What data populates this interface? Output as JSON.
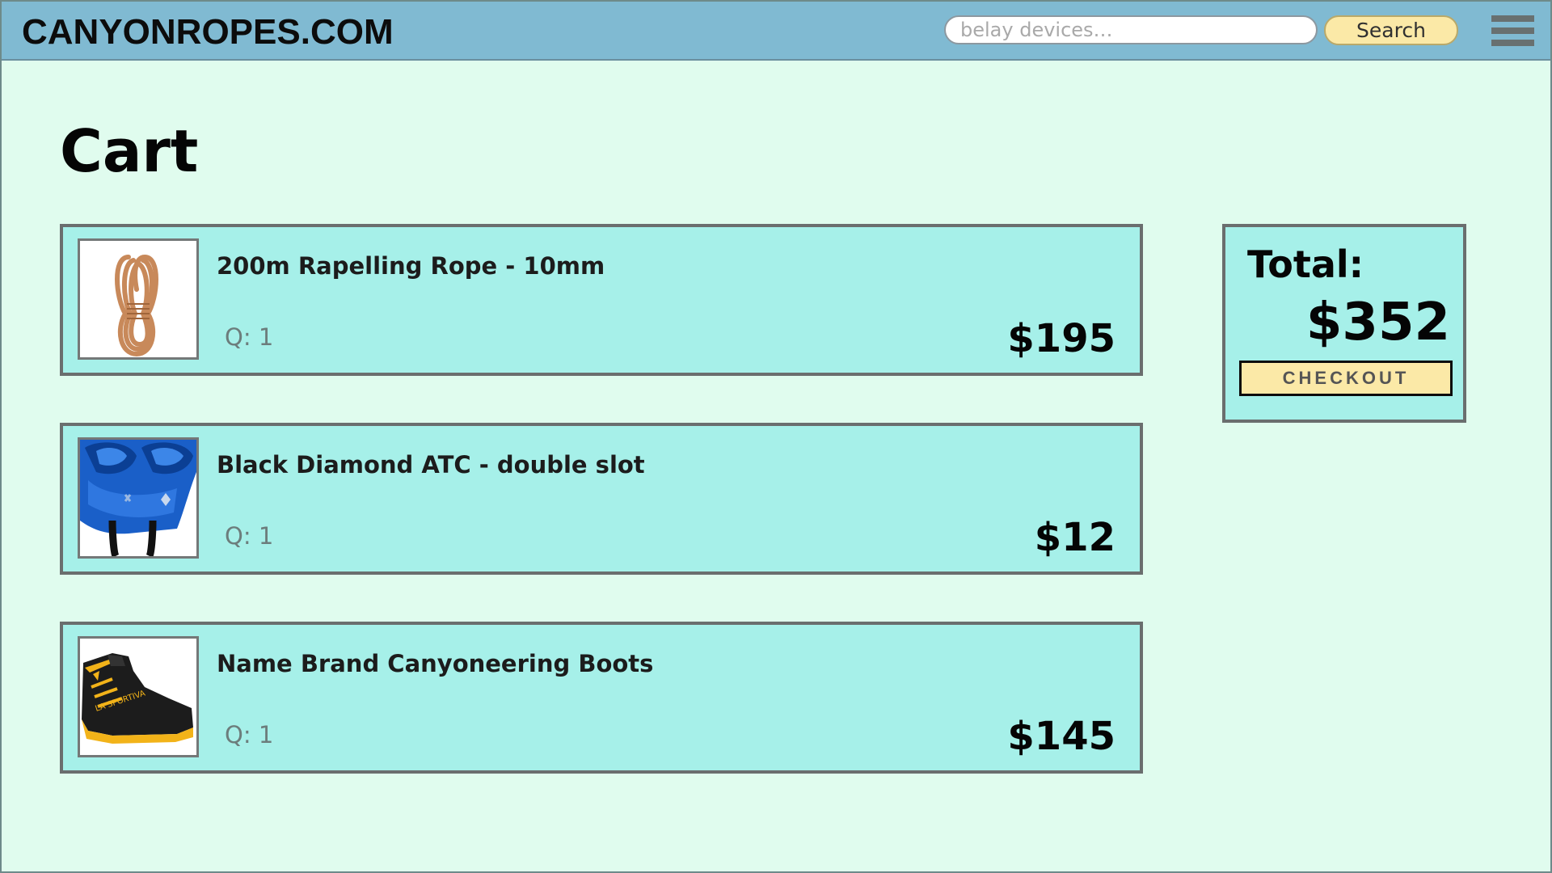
{
  "header": {
    "logo": "CANYONROPES.COM",
    "search_placeholder": "belay devices…",
    "search_button": "Search"
  },
  "page_title": "Cart",
  "cart": {
    "items": [
      {
        "name": "200m Rapelling Rope - 10mm",
        "qty": "Q: 1",
        "price": "$195",
        "image": "rope-image"
      },
      {
        "name": "Black Diamond ATC - double slot",
        "qty": "Q: 1",
        "price": "$12",
        "image": "belay-device-image"
      },
      {
        "name": "Name Brand Canyoneering Boots",
        "qty": "Q: 1",
        "price": "$145",
        "image": "boot-image"
      }
    ]
  },
  "summary": {
    "total_label": "Total:",
    "total_amount": "$352",
    "checkout_label": "CHECKOUT"
  },
  "colors": {
    "page_background": "#e0fcee",
    "header_background": "#80bad2",
    "card_background": "#a6f0e9",
    "button_yellow": "#fbe9a7",
    "border_gray": "#6a6e6e"
  }
}
